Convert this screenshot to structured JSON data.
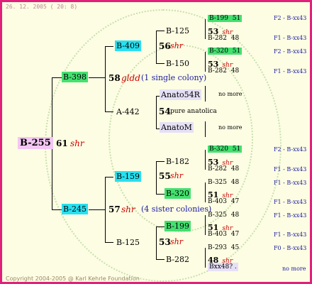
{
  "header": {
    "date": "26. 12. 2005 ( 20: 8)"
  },
  "footer": {
    "copyright": "Copyright 2004-2005 @ Karl Kehrle Foundation"
  },
  "root": {
    "id": "B-255",
    "year": "61",
    "breed": "shr"
  },
  "gen1": [
    {
      "id": "B-398",
      "year": "58",
      "breed": "gldd",
      "note": "(1 single colony)"
    },
    {
      "id": "B-245",
      "year": "57",
      "breed": "shr",
      "note": "(4 sister colonies)"
    }
  ],
  "gen2": [
    {
      "id": "B-409",
      "year": "56",
      "breed": "shr"
    },
    {
      "id": "A-442",
      "year": "54",
      "breed": "pure anatolica"
    },
    {
      "id": "B-159",
      "year": "55",
      "breed": "shr"
    },
    {
      "id": "B-125",
      "year": "53",
      "breed": "shr"
    }
  ],
  "gen3": [
    {
      "id": "B-125"
    },
    {
      "id": "B-150"
    },
    {
      "id": "Anato54R"
    },
    {
      "id": "AnatoM"
    },
    {
      "id": "B-182"
    },
    {
      "id": "B-320"
    },
    {
      "id": "B-199"
    },
    {
      "id": "B-282"
    }
  ],
  "gen4": [
    {
      "id": "B-199",
      "year": "51"
    },
    {
      "year": "53",
      "breed": "shr"
    },
    {
      "id": "B-282",
      "year": "48"
    },
    {
      "id": "B-320",
      "year": "51"
    },
    {
      "year": "53",
      "breed": "shr"
    },
    {
      "id": "B-282",
      "year": "48"
    },
    {
      "no_more": "no more"
    },
    {
      "no_more": "no more"
    },
    {
      "id": "B-320",
      "year": "51"
    },
    {
      "year": "53",
      "breed": "shr"
    },
    {
      "id": "B-282",
      "year": "48"
    },
    {
      "id": "B-325",
      "year": "48"
    },
    {
      "year": "51",
      "breed": "shr"
    },
    {
      "id": "B-403",
      "year": "47"
    },
    {
      "id": "B-325",
      "year": "48"
    },
    {
      "year": "51",
      "breed": "shr"
    },
    {
      "id": "B-403",
      "year": "47"
    },
    {
      "id": "B-293",
      "year": "45"
    },
    {
      "year": "48",
      "breed": "shr"
    },
    {
      "id": "Bxx48?",
      "year": "."
    }
  ],
  "right_labels": [
    "F2 - B-xx43",
    "F1 - B-xx43",
    "F2 - B-xx43",
    "F1 - B-xx43",
    "F2 - B-xx43",
    "F1 - B-xx43",
    "F1 - B-xx43",
    "F1 - B-xx43",
    "F1 - B-xx43",
    "F1 - B-xx43",
    "F0 - B-xx43",
    "no more"
  ]
}
